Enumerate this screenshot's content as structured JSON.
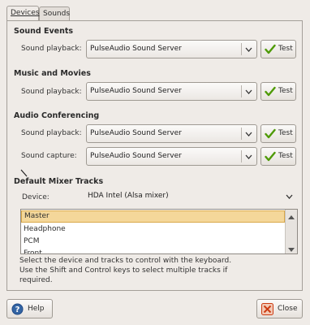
{
  "tabs": [
    {
      "label": "Devices"
    },
    {
      "label": "Sounds"
    }
  ],
  "sections": {
    "sound_events": {
      "title": "Sound Events",
      "playback_label": "Sound playback:",
      "playback_value": "PulseAudio Sound Server",
      "test_label": "Test"
    },
    "music_movies": {
      "title": "Music and Movies",
      "playback_label": "Sound playback:",
      "playback_value": "PulseAudio Sound Server",
      "test_label": "Test"
    },
    "audio_conf": {
      "title": "Audio Conferencing",
      "playback_label": "Sound playback:",
      "playback_value": "PulseAudio Sound Server",
      "capture_label": "Sound capture:",
      "capture_value": "PulseAudio Sound Server",
      "test_label": "Test"
    },
    "mixer": {
      "title": "Default Mixer Tracks",
      "device_label": "Device:",
      "device_value": "HDA Intel (Alsa mixer)"
    }
  },
  "tracks": [
    "Master",
    "Headphone",
    "PCM",
    "Front"
  ],
  "help_lines": [
    "Select the device and tracks to control with the keyboard.",
    "Use the Shift and Control keys to select multiple tracks if",
    "required."
  ],
  "footer": {
    "help_label": "Help",
    "close_label": "Close"
  },
  "colors": {
    "check": "#4e9a06",
    "close_icon": "#cc3b12",
    "help_icon": "#3465a4",
    "selection": "#f4d79a"
  }
}
